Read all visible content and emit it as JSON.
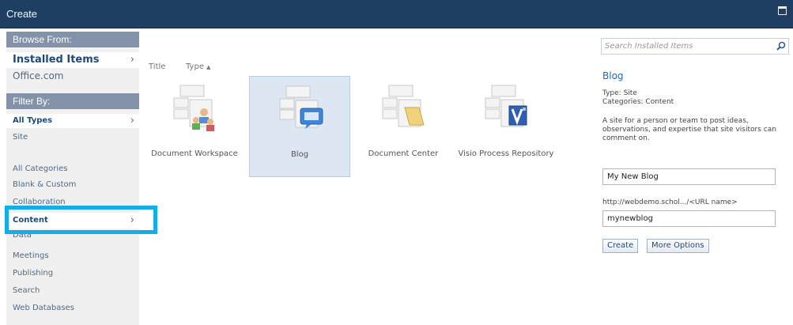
{
  "window": {
    "title": "Create"
  },
  "nav": {
    "browse_header": "Browse From:",
    "browse_items": [
      {
        "label": "Installed Items",
        "selected": true
      },
      {
        "label": "Office.com",
        "selected": false
      }
    ],
    "filter_header": "Filter By:",
    "type_items": [
      {
        "label": "All Types",
        "selected": true
      },
      {
        "label": "Site",
        "selected": false
      }
    ],
    "category_items": [
      {
        "label": "All Categories"
      },
      {
        "label": "Blank & Custom"
      },
      {
        "label": "Collaboration"
      },
      {
        "label": "Content",
        "selected": true
      },
      {
        "label": "Data"
      },
      {
        "label": "Meetings"
      },
      {
        "label": "Publishing"
      },
      {
        "label": "Search"
      },
      {
        "label": "Web Databases"
      }
    ],
    "chevron": "›"
  },
  "sortbar": {
    "title_label": "Title",
    "type_label": "Type",
    "sort_arrow": "▲"
  },
  "tiles": [
    {
      "label": "Document Workspace",
      "icon": "document-workspace-icon",
      "selected": false
    },
    {
      "label": "Blog",
      "icon": "blog-icon",
      "selected": true
    },
    {
      "label": "Document Center",
      "icon": "document-center-icon",
      "selected": false
    },
    {
      "label": "Visio Process Repository",
      "icon": "visio-icon",
      "selected": false
    }
  ],
  "details": {
    "search_placeholder": "Search Installed Items",
    "title": "Blog",
    "type_line": "Type: Site",
    "categories_line": "Categories: Content",
    "description": "A site for a person or team to post ideas, observations, and expertise that site visitors can comment on.",
    "name_value": "My New Blog",
    "url_label": "http://webdemo.schol.../<URL name>",
    "url_value": "mynewblog",
    "create_label": "Create",
    "more_options_label": "More Options"
  },
  "colors": {
    "titlebar": "#1e3f63",
    "nav_header": "#8392a8",
    "highlight": "#13aee8",
    "link": "#1b6bc0"
  }
}
